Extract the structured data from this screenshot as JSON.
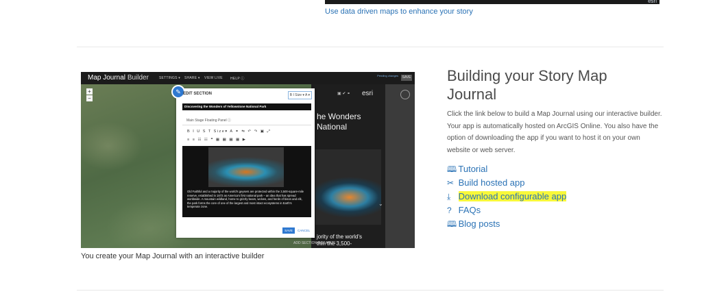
{
  "top": {
    "thumbnail_logo": "esri",
    "link_label": "Use data driven maps to enhance your story"
  },
  "screenshot": {
    "brand_name": "Map Journal",
    "brand_suffix": "Builder",
    "menu": [
      "SETTINGS ▾",
      "SHARE ▾",
      "VIEW LIVE",
      "HELP ⓘ"
    ],
    "pending_text": "Pending changes",
    "save_label": "SAVE",
    "zoom_in": "+",
    "zoom_out": "−",
    "panel_heading": "he Wonders\nNational",
    "panel_caption": "jority of the world's\nthin the 3,500-",
    "panel_logo": "esri",
    "bottom_tabs": "ADD SECTION      ORGANIZE",
    "dialog": {
      "title": "EDIT SECTION",
      "format_bar": "B  I    Size ▾   A ▾",
      "section_title": "Discovering the Wonders of Yellowstone National Park",
      "tabs": "Main Stage      Floating Panel      ⓘ",
      "toolbar_row1": "B I U S T  Size▾ A ⚭ ⇋ ↶ ↷  ▣ ⤢",
      "toolbar_row2": "≡ ≡ ☷ ☷ ❝ ▦ ▦ ▦ ▦ ▶",
      "body_text": "Old Faithful and a majority of the world's geysers are protected within the 3,500-square-mile reserve, established in 1872 as America's first national park – an idea that has spread worldwide. A mountain wildland, home to grizzly bears, wolves, and herds of bison and elk, the park forms the core of one of the largest and most intact ecosystems in Earth's temperate zone.",
      "save_label": "SAVE",
      "cancel_label": "CANCEL"
    }
  },
  "caption": "You create your Map Journal with an interactive builder",
  "section": {
    "heading": "Building your Story Map Journal",
    "description": "Click the link below to build a Map Journal using our interactive builder. Your app is automatically hosted on ArcGIS Online. You also have the option of downloading the app if you want to host it on your own website or web server.",
    "links": [
      {
        "icon": "map-book-icon",
        "glyph": "🕮",
        "label": "Tutorial"
      },
      {
        "icon": "wrench-icon",
        "glyph": "✂",
        "label": "Build hosted app"
      },
      {
        "icon": "download-icon",
        "glyph": "⤓",
        "label": "Download configurable app"
      },
      {
        "icon": "question-icon",
        "glyph": "?",
        "label": "FAQs"
      },
      {
        "icon": "open-book-icon",
        "glyph": "🕮",
        "label": "Blog posts"
      }
    ],
    "highlight_color": "#f8f83a",
    "link_color": "#2a72b5"
  }
}
